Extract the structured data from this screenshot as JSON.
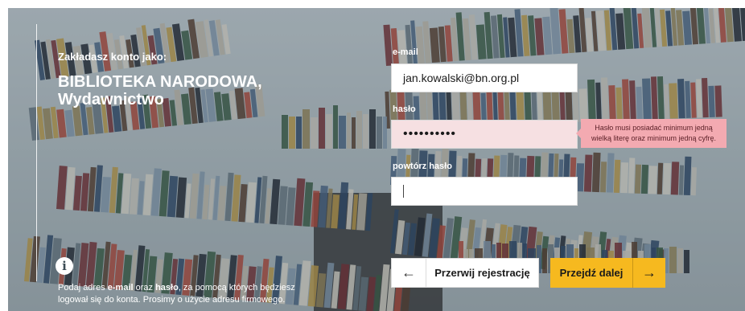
{
  "account": {
    "intro": "Zakładasz konto jako:",
    "org_line1": "BIBLIOTEKA NARODOWA,",
    "org_line2": "Wydawnictwo"
  },
  "form": {
    "email_label": "e-mail",
    "email_value": "jan.kowalski@bn.org.pl",
    "password_label": "hasło",
    "password_value": "••••••••••",
    "repeat_label": "powtórz hasło",
    "repeat_value": ""
  },
  "tooltip": {
    "password_error": "Hasło musi posiadać minimum jedną wielką literę oraz minimum jedną cyfrę."
  },
  "info": {
    "icon": "info-icon",
    "text_1": "Podaj adres ",
    "bold_1": "e-mail",
    "text_2": " oraz ",
    "bold_2": "hasło",
    "text_3": ", za pomocą których będziesz logował się do konta. Prosimy o użycie adresu firmowego."
  },
  "buttons": {
    "back_label": "Przerwij rejestrację",
    "back_icon": "arrow-left-icon",
    "next_label": "Przejdź dalej",
    "next_icon": "arrow-right-icon"
  },
  "colors": {
    "accent": "#f6b91f",
    "error_bg": "#f3aab1",
    "error_field": "#f6e0e2"
  }
}
